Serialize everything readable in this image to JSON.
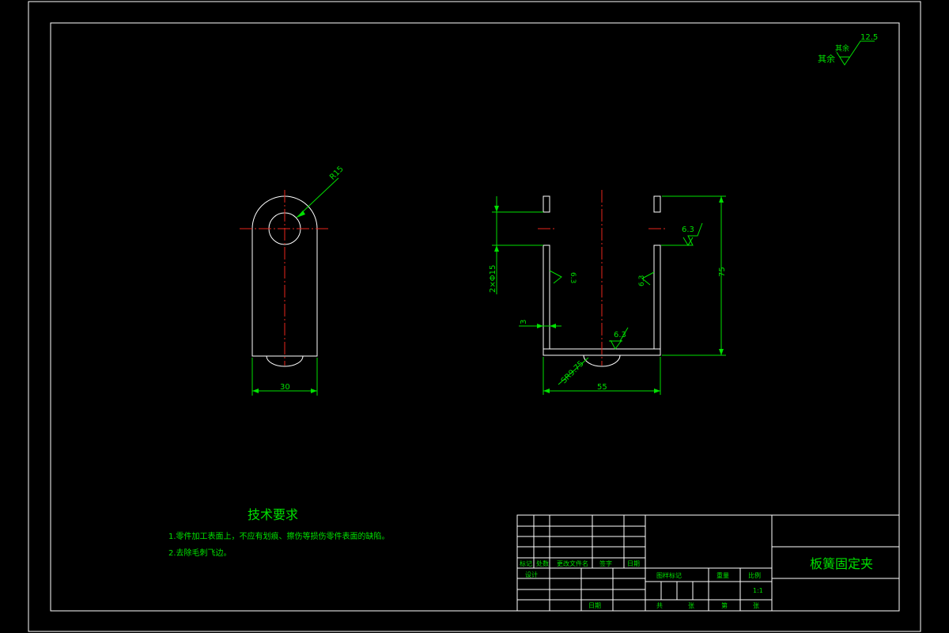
{
  "colors": {
    "background": "#000000",
    "outline": "#ffffff",
    "centerline": "#e8261d",
    "annotation": "#00e000"
  },
  "roughness": {
    "other_label": "其余",
    "other_value": "12.5",
    "face_value": "6.3"
  },
  "dimensions": {
    "radius": "R15",
    "width_left": "30",
    "holes": "2×Φ15",
    "thickness": "3",
    "sphere": "SR9.75",
    "width_right": "55",
    "height": "75"
  },
  "tech": {
    "title": "技术要求",
    "notes": [
      "1.零件加工表面上，不应有划痕、擦伤等损伤零件表面的缺陷。",
      "2.去除毛刺飞边。"
    ]
  },
  "title_block": {
    "part_name": "板簧固定夹",
    "scale": "1:1",
    "rev_headers": [
      "标记",
      "处数",
      "更改文件名",
      "签字",
      "日期"
    ],
    "design_label": "设计",
    "date_label": "日期",
    "stage_label": "图样标记",
    "weight_label": "重量",
    "scale_label": "比例",
    "sheet_total_label": "共",
    "sheet_label": "张",
    "sheet_num_label": "第",
    "sheet_num_unit": "张"
  }
}
